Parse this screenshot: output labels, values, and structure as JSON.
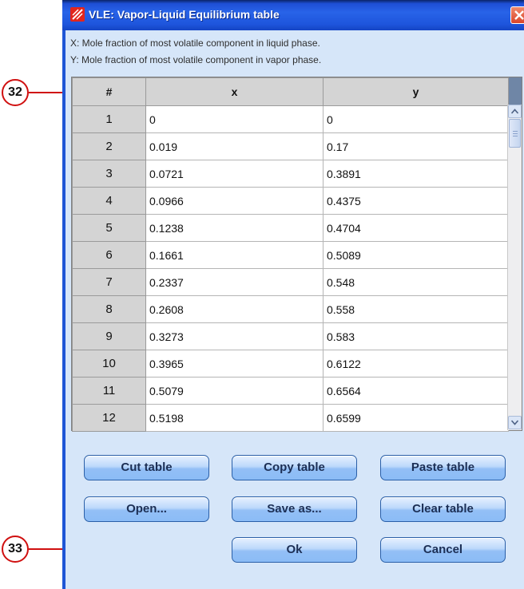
{
  "callouts": {
    "first": "32",
    "second": "33"
  },
  "window": {
    "title": "VLE: Vapor-Liquid Equilibrium table",
    "description_x": "X: Mole fraction of most volatile component in liquid phase.",
    "description_y": "Y: Mole fraction of most volatile component in vapor phase."
  },
  "table": {
    "headers": [
      "#",
      "x",
      "y"
    ],
    "rows": [
      {
        "n": "1",
        "x": "0",
        "y": "0"
      },
      {
        "n": "2",
        "x": "0.019",
        "y": "0.17"
      },
      {
        "n": "3",
        "x": "0.0721",
        "y": "0.3891"
      },
      {
        "n": "4",
        "x": "0.0966",
        "y": "0.4375"
      },
      {
        "n": "5",
        "x": "0.1238",
        "y": "0.4704"
      },
      {
        "n": "6",
        "x": "0.1661",
        "y": "0.5089"
      },
      {
        "n": "7",
        "x": "0.2337",
        "y": "0.548"
      },
      {
        "n": "8",
        "x": "0.2608",
        "y": "0.558"
      },
      {
        "n": "9",
        "x": "0.3273",
        "y": "0.583"
      },
      {
        "n": "10",
        "x": "0.3965",
        "y": "0.6122"
      },
      {
        "n": "11",
        "x": "0.5079",
        "y": "0.6564"
      },
      {
        "n": "12",
        "x": "0.5198",
        "y": "0.6599"
      }
    ]
  },
  "buttons": {
    "cut": "Cut table",
    "copy": "Copy table",
    "paste": "Paste table",
    "open": "Open...",
    "save_as": "Save as...",
    "clear": "Clear table",
    "ok": "Ok",
    "cancel": "Cancel"
  },
  "icons": {
    "title": "app-logo-icon",
    "close": "close-icon",
    "scroll_up": "scroll-up-arrow-icon",
    "scroll_down": "scroll-down-arrow-icon"
  },
  "colors": {
    "titlebar": "#2863e8",
    "dialog_bg": "#d6e6f9",
    "button": "#93bff6",
    "callout": "#d01010",
    "close_button": "#d9452a"
  }
}
